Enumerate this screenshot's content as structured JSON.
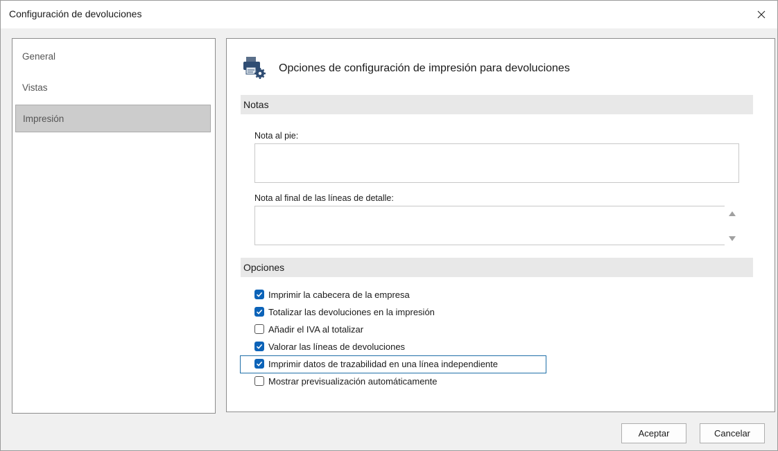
{
  "window": {
    "title": "Configuración de devoluciones"
  },
  "nav": {
    "items": [
      {
        "label": "General"
      },
      {
        "label": "Vistas"
      },
      {
        "label": "Impresión"
      }
    ]
  },
  "panel": {
    "title": "Opciones de configuración de impresión para devoluciones",
    "notas_section": "Notas",
    "nota_pie_label": "Nota al pie:",
    "nota_pie_value": "",
    "nota_final_label": "Nota al final de las líneas de detalle:",
    "nota_final_value": "",
    "opciones_section": "Opciones",
    "options": [
      {
        "label": "Imprimir la cabecera de la empresa",
        "checked": true
      },
      {
        "label": "Totalizar las devoluciones en la impresión",
        "checked": true
      },
      {
        "label": "Añadir el IVA al totalizar",
        "checked": false
      },
      {
        "label": "Valorar las líneas de devoluciones",
        "checked": true
      },
      {
        "label": "Imprimir datos de trazabilidad en una línea independiente",
        "checked": true
      },
      {
        "label": "Mostrar previsualización automáticamente",
        "checked": false
      }
    ]
  },
  "buttons": {
    "accept": "Aceptar",
    "cancel": "Cancelar"
  },
  "colors": {
    "checkbox_checked": "#0c63b8",
    "focus_border": "#1f6fa8",
    "nav_selected": "#cccccc",
    "section_bg": "#e8e8e8"
  },
  "icons": {
    "header": "printer-settings-icon",
    "close": "close-icon"
  }
}
